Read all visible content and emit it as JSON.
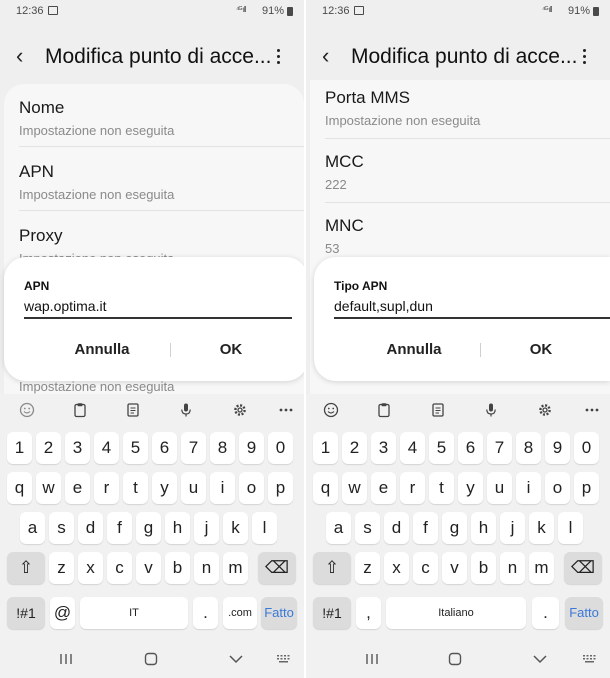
{
  "colors": {
    "accent_blue": "#3a78d9",
    "background": "#efefef",
    "dialog_bg": "#ffffff"
  },
  "status": {
    "time": "12:36",
    "battery": "91%",
    "icons": [
      "image-icon",
      "signal-icon",
      "battery-icon"
    ]
  },
  "left": {
    "title": "Modifica punto di acce...",
    "items": [
      {
        "title": "Nome",
        "subtitle": "Impostazione non eseguita"
      },
      {
        "title": "APN",
        "subtitle": "Impostazione non eseguita"
      },
      {
        "title": "Proxy",
        "subtitle": "Impostazione non eseguita"
      }
    ],
    "below_dialog_text": "Impostazione non eseguita",
    "dialog": {
      "label": "APN",
      "value": "wap.optima.it",
      "cancel": "Annulla",
      "ok": "OK"
    },
    "space_label": "IT",
    "symbols_key": "!#1",
    "extra_key": "@",
    "dot_key": ".",
    "com_key": ".com",
    "done_key": "Fatto"
  },
  "right": {
    "title": "Modifica punto di acce...",
    "items": [
      {
        "title": "Porta MMS",
        "subtitle": "Impostazione non eseguita"
      },
      {
        "title": "MCC",
        "subtitle": "222"
      },
      {
        "title": "MNC",
        "subtitle": "53"
      }
    ],
    "dialog": {
      "label": "Tipo APN",
      "value": "default,supl,dun",
      "cancel": "Annulla",
      "ok": "OK"
    },
    "space_label": "Italiano",
    "symbols_key": "!#1",
    "extra_key": ",",
    "dot_key": ".",
    "done_key": "Fatto"
  },
  "keyboard": {
    "row_numbers": [
      "1",
      "2",
      "3",
      "4",
      "5",
      "6",
      "7",
      "8",
      "9",
      "0"
    ],
    "row_1": [
      "q",
      "w",
      "e",
      "r",
      "t",
      "y",
      "u",
      "i",
      "o",
      "p"
    ],
    "row_2": [
      "a",
      "s",
      "d",
      "f",
      "g",
      "h",
      "j",
      "k",
      "l"
    ],
    "row_3": [
      "z",
      "x",
      "c",
      "v",
      "b",
      "n",
      "m"
    ],
    "toolbar_icons": [
      "emoji-icon",
      "clipboard-icon",
      "notes-icon",
      "microphone-icon",
      "settings-icon",
      "more-icon"
    ]
  }
}
